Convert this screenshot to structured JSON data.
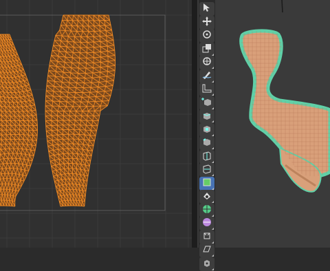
{
  "colors": {
    "uv_background": "#303030",
    "uv_grid": "#3a3a3a",
    "uv_bounds": "#5a5a5a",
    "mesh_orange": "#f08a24",
    "mesh_orange_dark": "#b85f10",
    "viewport_background": "#3a3a3a",
    "chair_surface": "#d9a07a",
    "selection_outline": "#5fd1a8",
    "toolbar_background": "#2a2a2a"
  },
  "toolbar": {
    "tools": [
      {
        "icon": "cursor-icon"
      },
      {
        "icon": "move-icon"
      },
      {
        "icon": "rotate-icon"
      },
      {
        "icon": "scale-icon"
      },
      {
        "icon": "transform-icon"
      },
      {
        "icon": "annotate-icon"
      },
      {
        "icon": "measure-icon"
      },
      {
        "icon": "add-cube-icon"
      },
      {
        "icon": "extrude-icon"
      },
      {
        "icon": "inset-icon"
      },
      {
        "icon": "bevel-icon"
      },
      {
        "icon": "loop-cut-icon"
      },
      {
        "icon": "knife-icon"
      },
      {
        "icon": "poly-build-icon"
      },
      {
        "icon": "spin-icon"
      },
      {
        "icon": "smooth-icon"
      },
      {
        "icon": "edge-slide-icon"
      },
      {
        "icon": "shrink-fatten-icon"
      },
      {
        "icon": "shear-icon"
      },
      {
        "icon": "rip-icon"
      }
    ]
  }
}
